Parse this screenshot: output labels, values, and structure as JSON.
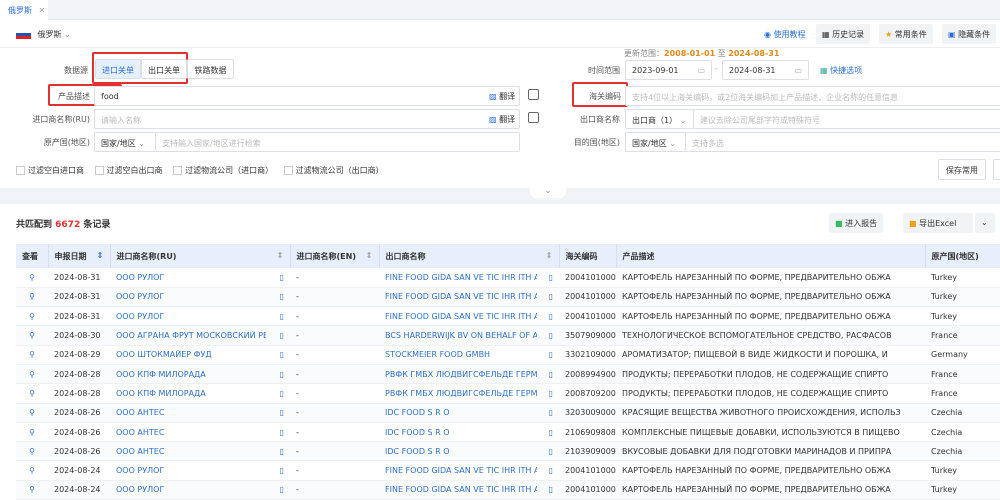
{
  "tab": {
    "label": "俄罗斯",
    "close": "✕"
  },
  "country": {
    "name": "俄罗斯"
  },
  "toolbar": {
    "tutorial": "使用教程",
    "history": "历史记录",
    "favorites": "常用条件",
    "hide": "隐藏条件"
  },
  "update": {
    "label": "更新范围：",
    "from": "2008-01-01",
    "sep": "至",
    "to": "2024-08-31"
  },
  "form": {
    "datasource_label": "数据源",
    "ds_options": [
      "进口关单",
      "出口关单",
      "铁路数据"
    ],
    "product_label": "产品描述",
    "product_value": "food",
    "translate": "翻译",
    "importer_label": "进口商名称(RU)",
    "importer_placeholder": "请输入名称",
    "origin_label": "原产国(地区)",
    "origin_select": "国家/地区",
    "origin_placeholder": "支持输入国家/地区进行检索",
    "time_label": "时间范围",
    "date_from": "2023-09-01",
    "date_to": "2024-08-31",
    "quick": "快捷选项",
    "hs_label": "海关编码",
    "hs_placeholder": "支持4位以上海关编码，或2位海关编码加上产品描述、企业名称的任意信息",
    "exporter_label": "出口商名称",
    "exporter_select": "出口商（1）",
    "exporter_placeholder": "建议去除公司尾部字符或特殊符号",
    "dest_label": "目的国(地区)",
    "dest_select": "国家/地区",
    "dest_placeholder": "支持多选",
    "filters": [
      "过滤空白进口商",
      "过滤空白出口商",
      "过滤物流公司（进口商）",
      "过滤物流公司（出口商）"
    ],
    "save": "保存常用"
  },
  "results": {
    "prefix": "共匹配到",
    "count": "6672",
    "suffix": "条记录",
    "report": "进入报告",
    "export": "导出Excel"
  },
  "table": {
    "headers": [
      "查看",
      "申报日期",
      "进口商名称(RU)",
      "进口商名称(EN)",
      "出口商名称",
      "海关编码",
      "产品描述",
      "原产国(地区)"
    ],
    "rows": [
      [
        "2024-08-31",
        "ООО РУЛОГ",
        "-",
        "FINE FOOD GIDA SAN VE TIC IHR ITH A S",
        "2004101000",
        "КАРТОФЕЛЬ НАРЕЗАННЫЙ ПО ФОРМЕ, ПРЕДВАРИТЕЛЬНО ОБЖА",
        "Turkey"
      ],
      [
        "2024-08-31",
        "ООО РУЛОГ",
        "-",
        "FINE FOOD GIDA SAN VE TIC IHR ITH A S",
        "2004101000",
        "КАРТОФЕЛЬ НАРЕЗАННЫЙ ПО ФОРМЕ, ПРЕДВАРИТЕЛЬНО ОБЖА",
        "Turkey"
      ],
      [
        "2024-08-31",
        "ООО РУЛОГ",
        "-",
        "FINE FOOD GIDA SAN VE TIC IHR ITH A S",
        "2004101000",
        "КАРТОФЕЛЬ НАРЕЗАННЫЙ ПО ФОРМЕ, ПРЕДВАРИТЕЛЬНО ОБЖА",
        "Turkey"
      ],
      [
        "2024-08-30",
        "ООО АГРАНА ФРУТ МОСКОВСКИЙ РЕГ",
        "-",
        "BCS HARDERWIJK BV ON BEHALF OF AG",
        "3507909000",
        "ТЕХНОЛОГИЧЕСКОЕ ВСПОМОГАТЕЛЬНОЕ СРЕДСТВО, РАСФАСОВ",
        "France"
      ],
      [
        "2024-08-29",
        "ООО ШТОКМАЙЕР ФУД",
        "-",
        "STOCKMEIER FOOD GMBH",
        "3302109000",
        "АРОМАТИЗАТОР; ПИЩЕВОЙ В ВИДЕ ЖИДКОСТИ И ПОРОШКА, И",
        "Germany"
      ],
      [
        "2024-08-28",
        "ООО КПФ МИЛОРАДА",
        "-",
        "РВФК ГМБХ ЛЮДВИГСФЕЛЬДЕ ГЕРМАН",
        "2008994900",
        "ПРОДУКТЫ; ПЕРЕРАБОТКИ ПЛОДОВ, НЕ СОДЕРЖАЩИЕ СПИРТО",
        "France"
      ],
      [
        "2024-08-28",
        "ООО КПФ МИЛОРАДА",
        "-",
        "РВФК ГМБХ ЛЮДВИГСФЕЛЬДЕ ГЕРМАН",
        "2008709200",
        "ПРОДУКТЫ; ПЕРЕРАБОТКИ ПЛОДОВ, НЕ СОДЕРЖАЩИЕ СПИРТО",
        "France"
      ],
      [
        "2024-08-26",
        "ООО АНТЕС",
        "-",
        "IDC FOOD S R O",
        "3203009000",
        "КРАСЯЩИЕ ВЕЩЕСТВА ЖИВОТНОГО ПРОИСХОЖДЕНИЯ, ИСПОЛЬЗ",
        "Czechia"
      ],
      [
        "2024-08-26",
        "ООО АНТЕС",
        "-",
        "IDC FOOD S R O",
        "2106909808",
        "КОМПЛЕКСНЫЕ ПИЩЕВЫЕ ДОБАВКИ, ИСПОЛЬЗУЮТСЯ В ПИЩЕВО",
        "Czechia"
      ],
      [
        "2024-08-26",
        "ООО АНТЕС",
        "-",
        "IDC FOOD S R O",
        "2103909009",
        "ВКУСОВЫЕ ДОБАВКИ ДЛЯ ПОДГОТОВКИ МАРИНАДОВ И ПРИПРА",
        "Czechia"
      ],
      [
        "2024-08-24",
        "ООО РУЛОГ",
        "-",
        "FINE FOOD GIDA SAN VE TIC IHR ITH A S",
        "2004101000",
        "КАРТОФЕЛЬ НАРЕЗАННЫЙ ПО ФОРМЕ, ПРЕДВАРИТЕЛЬНО ОБЖА",
        "Turkey"
      ],
      [
        "2024-08-24",
        "ООО РУЛОГ",
        "-",
        "FINE FOOD GIDA SAN VE TIC IHR ITH A S",
        "2004101000",
        "КАРТОФЕЛЬ НАРЕЗАННЫЙ ПО ФОРМЕ, ПРЕДВАРИТЕЛЬНО ОБЖА",
        "Turkey"
      ]
    ]
  },
  "colors": {
    "accent": "#2b6fd6",
    "highlight": "#e03030",
    "date": "#e08a1e",
    "header_bg": "#e8effc"
  }
}
